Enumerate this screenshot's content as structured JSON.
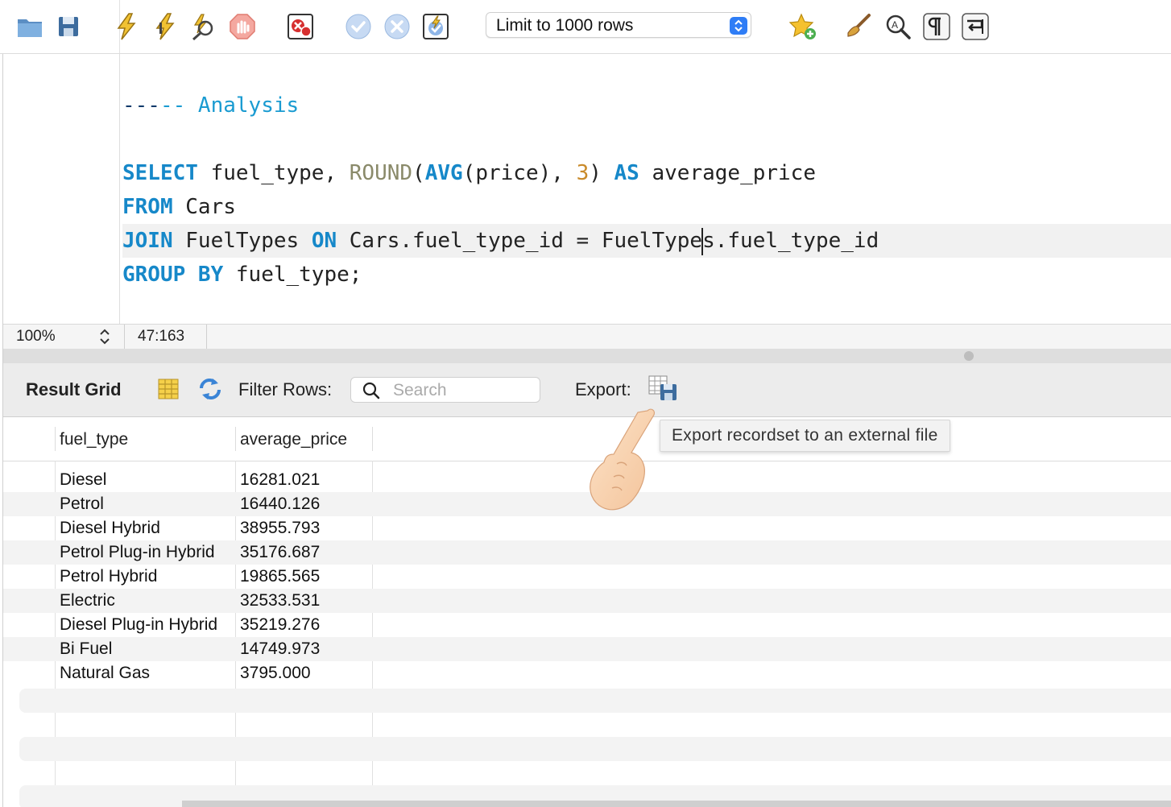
{
  "toolbar": {
    "icons": [
      "folder-icon",
      "save-icon",
      "execute-icon",
      "execute-current-icon",
      "explain-icon",
      "stop-icon",
      "toggle-error-icon",
      "commit-icon",
      "rollback-icon",
      "autocommit-icon",
      "bookmark-add-icon",
      "beautify-icon",
      "find-icon",
      "invisible-chars-icon",
      "wrap-icon"
    ],
    "limit_select": "Limit to 1000 rows"
  },
  "editor": {
    "comment_dashes": "---",
    "comment_text": "-- Analysis",
    "lines": {
      "select_kw": "SELECT",
      "select_cols": " fuel_type, ",
      "round_fn": "ROUND",
      "open_paren": "(",
      "avg_fn": "AVG",
      "avg_arg": "(price), ",
      "round_digits": "3",
      "close_paren": ") ",
      "as_kw": "AS",
      "alias": " average_price",
      "from_kw": "FROM",
      "from_table": " Cars",
      "join_kw": "JOIN",
      "join_table": " FuelTypes ",
      "on_kw": "ON",
      "join_cond_a": " Cars.fuel_type_id = FuelType",
      "join_cond_b": "s.fuel_type_id",
      "group_kw": "GROUP BY",
      "group_col": " fuel_type;"
    }
  },
  "status": {
    "zoom": "100%",
    "cursor": "47:163"
  },
  "result_toolbar": {
    "title": "Result Grid",
    "filter_label": "Filter Rows:",
    "search_placeholder": "Search",
    "export_label": "Export:"
  },
  "tooltip": "Export recordset to an external file",
  "grid": {
    "columns": [
      "fuel_type",
      "average_price"
    ],
    "rows": [
      [
        "Diesel",
        "16281.021"
      ],
      [
        "Petrol",
        "16440.126"
      ],
      [
        "Diesel Hybrid",
        "38955.793"
      ],
      [
        "Petrol Plug-in Hybrid",
        "35176.687"
      ],
      [
        "Petrol Hybrid",
        "19865.565"
      ],
      [
        "Electric",
        "32533.531"
      ],
      [
        "Diesel Plug-in Hybrid",
        "35219.276"
      ],
      [
        "Bi Fuel",
        "14749.973"
      ],
      [
        "Natural Gas",
        "3795.000"
      ]
    ]
  },
  "colors": {
    "keyword": "#1688c9",
    "comment": "#1a9bd1",
    "number": "#c98a2a",
    "select_accent": "#2f7df6"
  }
}
